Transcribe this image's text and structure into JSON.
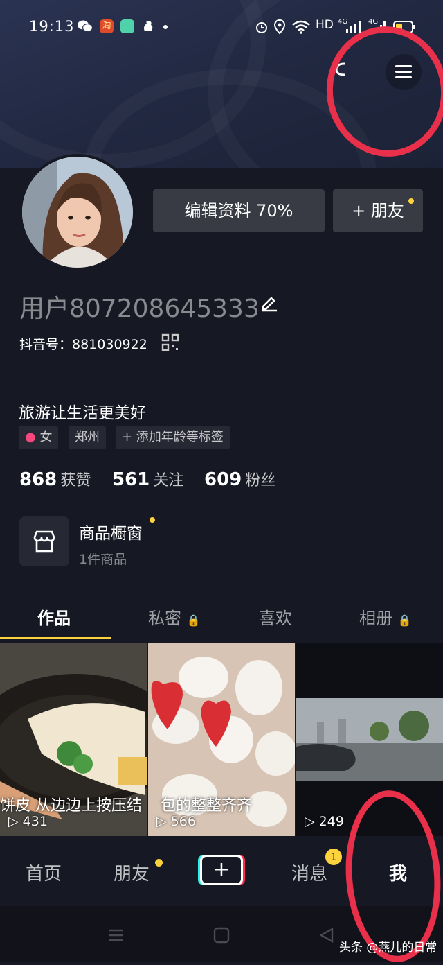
{
  "status_bar": {
    "time": "19:13",
    "network": "HD",
    "signal1": "4G",
    "signal2": "4G",
    "icons": [
      "wechat-icon",
      "taobao-icon",
      "app-icon",
      "squirrel-icon",
      "alarm-icon",
      "location-icon",
      "wifi-icon",
      "battery-icon"
    ]
  },
  "profile": {
    "edit_profile_label": "编辑资料 70%",
    "add_friend_label": "+ 朋友",
    "username": "用户807208645333",
    "douyin_id": "抖音号：881030922",
    "bio": "旅游让生活更美好",
    "tags": [
      "女",
      "郑州",
      "+ 添加年龄等标签"
    ],
    "stats": [
      {
        "num": "868",
        "label": "获赞"
      },
      {
        "num": "561",
        "label": "关注"
      },
      {
        "num": "609",
        "label": "粉丝"
      }
    ],
    "shop": {
      "title": "商品橱窗",
      "subtitle": "1件商品"
    }
  },
  "tabs": [
    "作品",
    "私密",
    "喜欢",
    "相册"
  ],
  "videos": [
    {
      "caption": "饼皮 从边边上按压结",
      "count": "431"
    },
    {
      "caption": "包的整整齐齐",
      "count": "566"
    },
    {
      "caption": "",
      "count": "249"
    }
  ],
  "bottom_nav": {
    "home": "首页",
    "friends": "朋友",
    "messages": "消息",
    "messages_badge": "1",
    "me": "我"
  },
  "watermark": "头条 @燕儿的日常",
  "colors": {
    "background": "#161823",
    "accent": "#fcd33c",
    "annotation": "#e8304a"
  }
}
